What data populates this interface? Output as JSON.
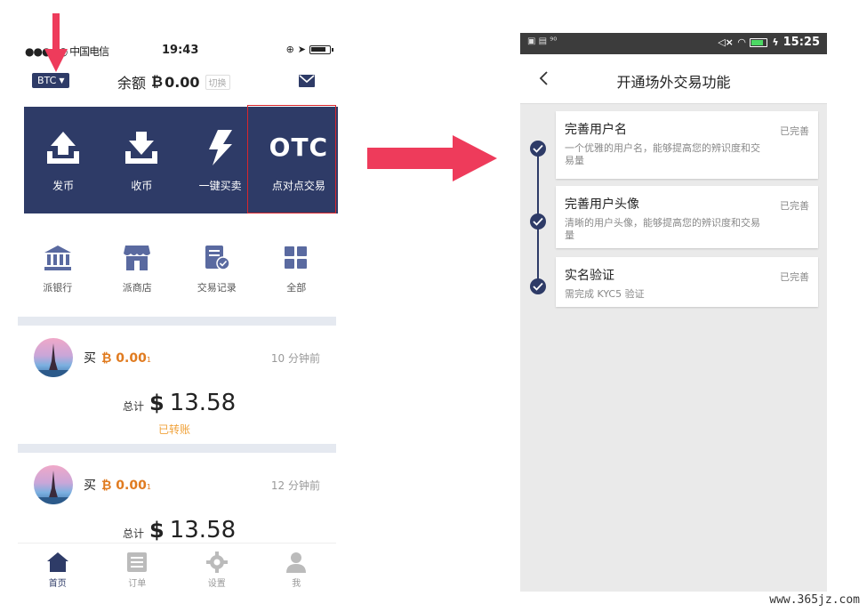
{
  "left_phone": {
    "status_bar": {
      "carrier": "●●●●○ 中国电信",
      "time": "19:43"
    },
    "header": {
      "currency": "BTC",
      "balance_label": "余额",
      "balance_symbol": "₿",
      "balance_value": "0.00",
      "switch_label": "切换",
      "mail_icon": "mail-icon"
    },
    "actions": [
      {
        "label": "发币",
        "icon": "upload-tray-icon"
      },
      {
        "label": "收币",
        "icon": "download-tray-icon"
      },
      {
        "label": "一键买卖",
        "icon": "lightning-icon"
      },
      {
        "label": "点对点交易",
        "icon_text": "OTC"
      }
    ],
    "quick_links": [
      {
        "label": "派银行",
        "icon": "bank-icon"
      },
      {
        "label": "派商店",
        "icon": "store-icon"
      },
      {
        "label": "交易记录",
        "icon": "record-icon"
      },
      {
        "label": "全部",
        "icon": "grid-icon"
      }
    ],
    "orders": [
      {
        "type": "买",
        "symbol": "₿",
        "amount": "0.00",
        "amount_suffix": "1",
        "time": "10 分钟前",
        "total_label": "总计",
        "currency_symbol": "$",
        "total": "13.58",
        "status": "已转账"
      },
      {
        "type": "买",
        "symbol": "₿",
        "amount": "0.00",
        "amount_suffix": "1",
        "time": "12 分钟前",
        "total_label": "总计",
        "currency_symbol": "$",
        "total": "13.58",
        "status": ""
      }
    ],
    "tabs": [
      {
        "label": "首页",
        "icon": "home-icon",
        "active": true
      },
      {
        "label": "订单",
        "icon": "list-icon",
        "active": false
      },
      {
        "label": "设置",
        "icon": "gear-icon",
        "active": false
      },
      {
        "label": "我",
        "icon": "user-icon",
        "active": false
      }
    ]
  },
  "right_phone": {
    "status_bar": {
      "time": "15:25"
    },
    "title": "开通场外交易功能",
    "steps": [
      {
        "title": "完善用户名",
        "desc": "一个优雅的用户名，能够提高您的辨识度和交易量",
        "status": "已完善"
      },
      {
        "title": "完善用户头像",
        "desc": "清晰的用户头像，能够提高您的辨识度和交易量",
        "status": "已完善"
      },
      {
        "title": "实名验证",
        "desc": "需完成 KYC5 验证",
        "status": "已完善"
      }
    ]
  },
  "watermark": "www.365jz.com",
  "colors": {
    "primary": "#2e3b67",
    "highlight": "#d9262c",
    "arrow": "#ee3b5b",
    "accent": "#e07b20"
  }
}
